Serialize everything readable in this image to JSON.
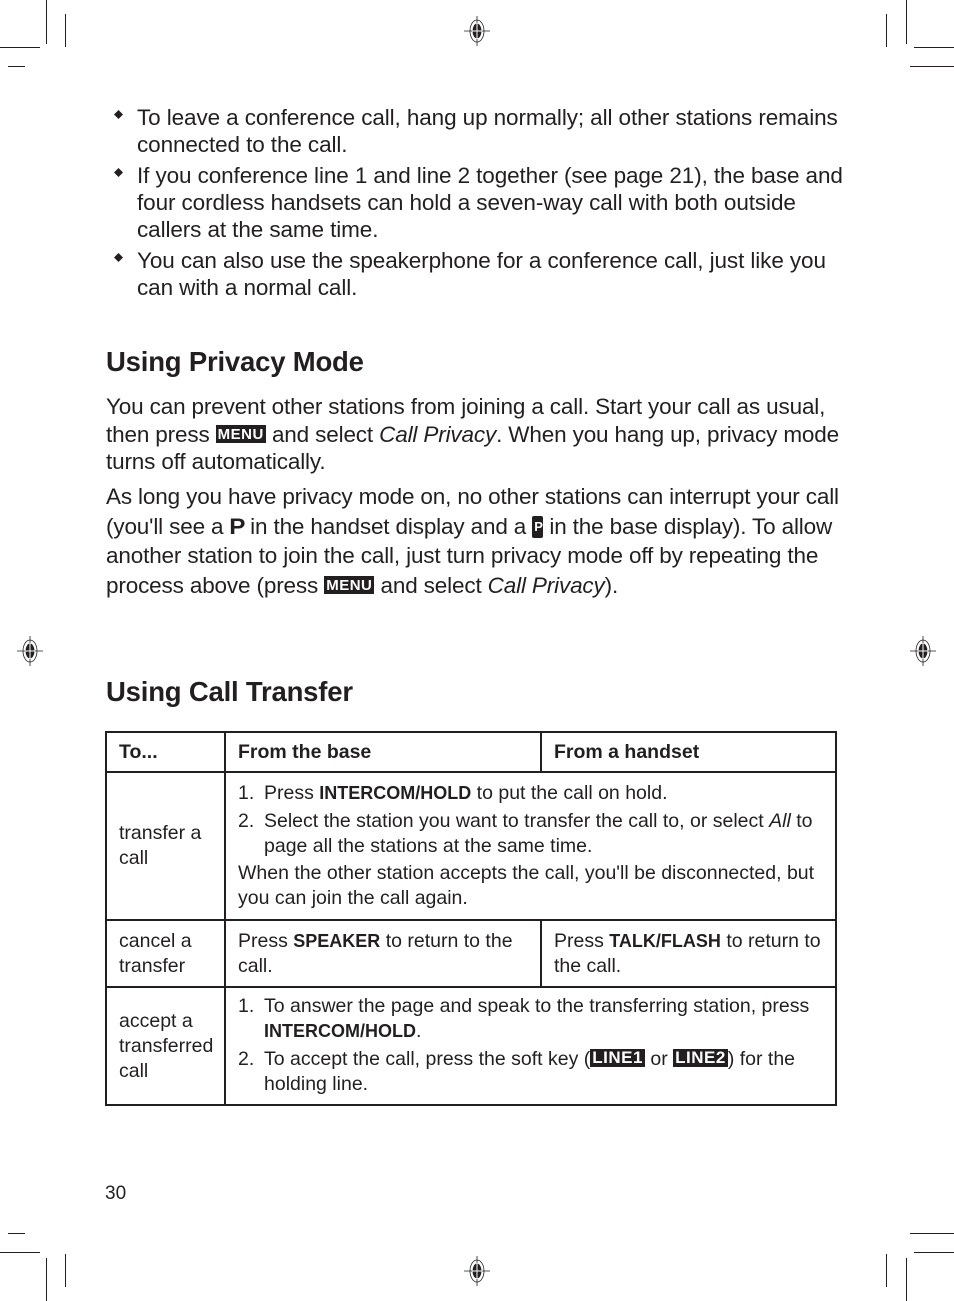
{
  "bullets": [
    "To leave a conference call, hang up normally; all other stations remains connected to the call.",
    "If you conference line 1 and line 2 together (see page 21), the base and four cordless handsets can hold a seven-way call with both outside callers at the same time.",
    "You can also use the speakerphone for a conference call, just like you can with a normal call."
  ],
  "privacy": {
    "heading": "Using Privacy Mode",
    "p1": {
      "a": "You can prevent other stations from joining a call. Start your call as usual, then press ",
      "key": "MENU",
      "b": " and select ",
      "em": "Call Privacy",
      "c": ". When you hang up, privacy mode turns off automatically."
    },
    "p2": {
      "a": "As long you have privacy mode on, no other stations can interrupt your call (you'll see a ",
      "handset_icon": "P",
      "b": " in the handset display and a ",
      "base_icon": "P",
      "c": " in the base display). To allow another station to join the call, just turn privacy mode off by repeating the process above (press ",
      "key": "MENU",
      "d": " and select ",
      "em": "Call Privacy",
      "e": ")."
    }
  },
  "transfer": {
    "heading": "Using Call Transfer",
    "table": {
      "headers": [
        "To...",
        "From the base",
        "From a handset"
      ],
      "rows": [
        {
          "action": "transfer a call",
          "step1": {
            "n": "1.",
            "a": "Press ",
            "b": "INTERCOM/HOLD",
            "c": " to put the call on hold."
          },
          "step2": {
            "n": "2.",
            "a": "Select the station you want to transfer the call to, or select ",
            "em": "All",
            "c": " to page all the stations at the same time."
          },
          "note": "When the other station accepts the call, you'll be disconnected, but you can join the call again."
        },
        {
          "action": "cancel a transfer",
          "base": {
            "a": "Press ",
            "b": "SPEAKER",
            "c": " to return to the call."
          },
          "handset": {
            "a": "Press ",
            "b": "TALK/FLASH",
            "c": " to return to the call."
          }
        },
        {
          "action": "accept a transferred call",
          "step1": {
            "n": "1.",
            "a": "To answer the page and speak to the transferring station, press ",
            "b": "INTERCOM/HOLD",
            "c": "."
          },
          "step2": {
            "n": "2.",
            "a": "To accept the call, press the soft key (",
            "key1": "LINE1",
            "mid": " or ",
            "key2": "LINE2",
            "c": ") for the holding line."
          }
        }
      ]
    }
  },
  "page_number": "30"
}
